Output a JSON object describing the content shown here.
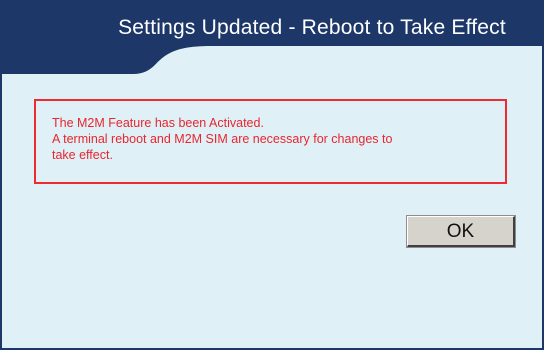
{
  "dialog": {
    "title": "Settings Updated - Reboot to Take Effect",
    "message_lines": [
      "The M2M Feature has been Activated.",
      "A terminal reboot and M2M SIM are necessary for changes to",
      "take effect."
    ],
    "ok_label": "OK"
  },
  "colors": {
    "title_bar": "#1c3768",
    "dialog_background": "#dff1f7",
    "message_border": "#ee2b35",
    "message_text": "#e8262f",
    "button_face": "#d6d3cc"
  }
}
